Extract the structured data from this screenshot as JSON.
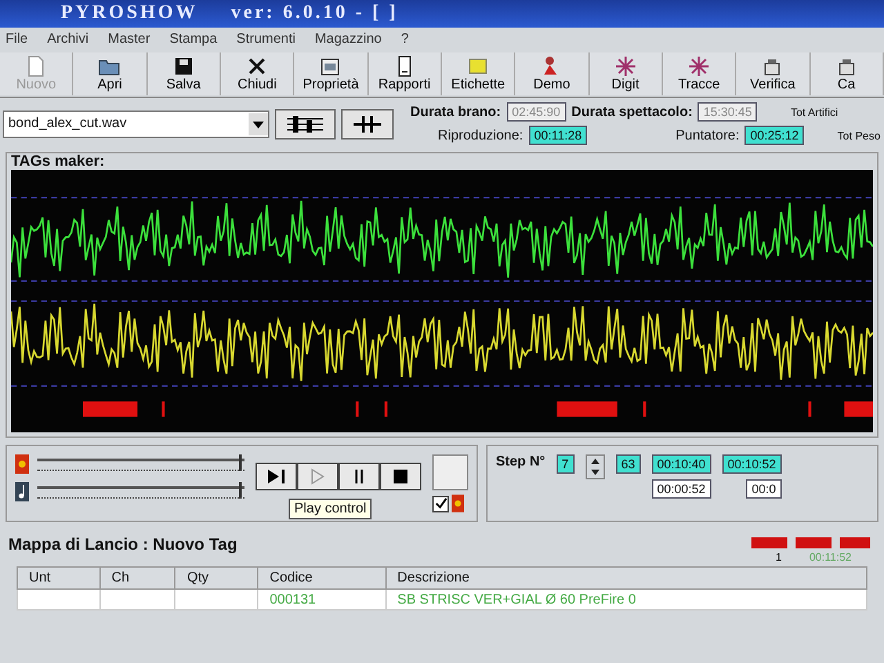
{
  "window": {
    "app_name": "PYROSHOW",
    "version": "ver: 6.0.10 - [ ]"
  },
  "menu": [
    "File",
    "Archivi",
    "Master",
    "Stampa",
    "Strumenti",
    "Magazzino",
    "?"
  ],
  "toolbar": [
    {
      "label": "Nuovo",
      "kind": "file",
      "disabled": true
    },
    {
      "label": "Apri",
      "kind": "folder",
      "disabled": false
    },
    {
      "label": "Salva",
      "kind": "disk",
      "disabled": false
    },
    {
      "label": "Chiudi",
      "kind": "close",
      "disabled": false
    },
    {
      "label": "Proprietà",
      "kind": "props",
      "disabled": false
    },
    {
      "label": "Rapporti",
      "kind": "report",
      "disabled": false
    },
    {
      "label": "Etichette",
      "kind": "label",
      "disabled": false
    },
    {
      "label": "Demo",
      "kind": "person",
      "disabled": false
    },
    {
      "label": "Digit",
      "kind": "star",
      "disabled": false
    },
    {
      "label": "Tracce",
      "kind": "star",
      "disabled": false
    },
    {
      "label": "Verifica",
      "kind": "check",
      "disabled": false
    },
    {
      "label": "Ca",
      "kind": "check",
      "disabled": false
    }
  ],
  "file_select": {
    "value": "bond_alex_cut.wav"
  },
  "info": {
    "durata_brano_label": "Durata brano:",
    "durata_brano": "02:45:90",
    "durata_spettacolo_label": "Durata spettacolo:",
    "durata_spettacolo": "15:30:45",
    "riproduzione_label": "Riproduzione:",
    "riproduzione": "00:11:28",
    "puntatore_label": "Puntatore:",
    "puntatore": "00:25:12",
    "tot_artifici_label": "Tot Artifici",
    "tot_peso_label": "Tot Peso"
  },
  "tags_maker": {
    "title": "TAGs maker:"
  },
  "sliders": [
    {
      "kind": "fire",
      "level": 0.97
    },
    {
      "kind": "music",
      "level": 0.97
    }
  ],
  "transport": [
    {
      "kind": "play-step"
    },
    {
      "kind": "play"
    },
    {
      "kind": "pause"
    },
    {
      "kind": "stop"
    }
  ],
  "tooltip": "Play control",
  "fire_check": {
    "checked": true
  },
  "step": {
    "label": "Step N°",
    "value": "7",
    "count": "63",
    "time_1": "00:10:40",
    "time_2": "00:10:52",
    "offset_1": "00:00:52",
    "offset_2": "00:0"
  },
  "launch_map": {
    "title": "Mappa di Lancio : Nuovo Tag",
    "marker_number": "1",
    "marker_time": "00:11:52"
  },
  "table": {
    "columns": [
      "Unt",
      "Ch",
      "Qty",
      "Codice",
      "Descrizione"
    ],
    "rows": [
      [
        "",
        "",
        "",
        "000131",
        "SB STRISC VER+GIAL Ø 60 PreFire 0"
      ]
    ]
  }
}
